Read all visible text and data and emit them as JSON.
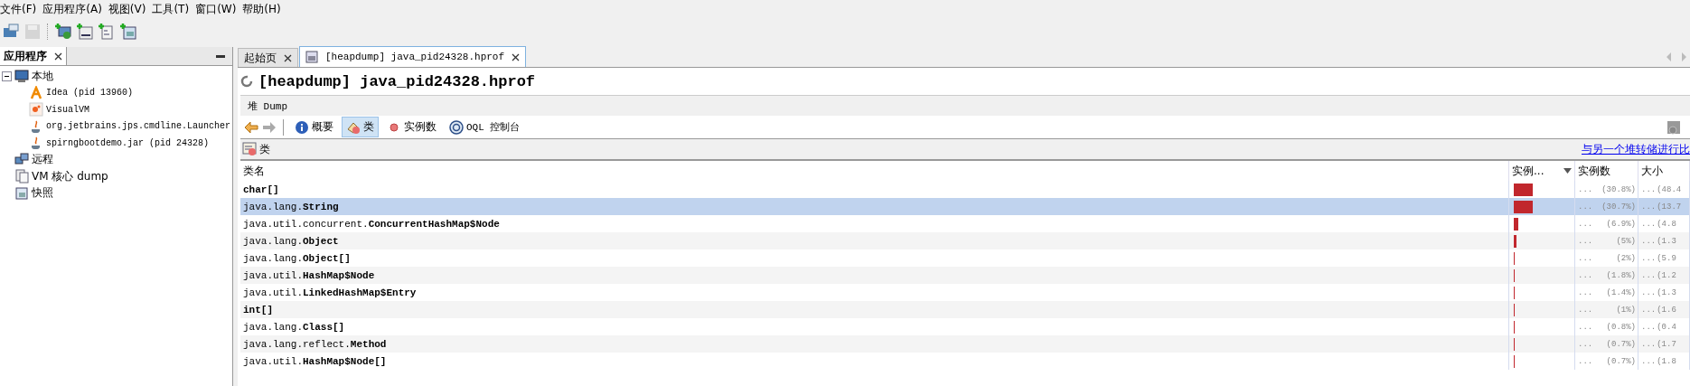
{
  "menu": [
    {
      "label": "文件(F)"
    },
    {
      "label": "应用程序(A)"
    },
    {
      "label": "视图(V)"
    },
    {
      "label": "工具(T)"
    },
    {
      "label": "窗口(W)"
    },
    {
      "label": "帮助(H)"
    }
  ],
  "toolbar": [
    {
      "kind": "open",
      "disabled": false
    },
    {
      "kind": "save",
      "disabled": true
    },
    {
      "kind": "add-host",
      "disabled": false
    },
    {
      "kind": "add-jmx",
      "disabled": false
    },
    {
      "kind": "add-dump",
      "disabled": false
    },
    {
      "kind": "add-snapshot",
      "disabled": false
    }
  ],
  "apps_panel": {
    "tab": "应用程序",
    "tree": [
      {
        "label": "本地",
        "kind": "host",
        "expanded": true,
        "children": [
          {
            "label": "Idea (pid 13960)",
            "kind": "idea"
          },
          {
            "label": "VisualVM",
            "kind": "visualvm"
          },
          {
            "label": "org.jetbrains.jps.cmdline.Launcher",
            "kind": "java"
          },
          {
            "label": "spirngbootdemo.jar (pid 24328)",
            "kind": "java"
          }
        ]
      },
      {
        "label": "远程",
        "kind": "remote"
      },
      {
        "label": "VM 核心 dump",
        "kind": "coredump"
      },
      {
        "label": "快照",
        "kind": "snapshot"
      }
    ]
  },
  "editor_tabs": [
    {
      "label": "起始页",
      "selected": false
    },
    {
      "label": "[heapdump] java_pid24328.hprof",
      "selected": true
    }
  ],
  "heap": {
    "title": "[heapdump] java_pid24328.hprof",
    "subtitle": "堆 Dump",
    "views": [
      {
        "label": "概要",
        "kind": "info",
        "selected": false
      },
      {
        "label": "类",
        "kind": "classes",
        "selected": true
      },
      {
        "label": "实例数",
        "kind": "instances",
        "selected": false
      },
      {
        "label": "OQL 控制台",
        "kind": "oql",
        "selected": false
      }
    ],
    "section": "类",
    "compare_link": "与另一个堆转储进行比",
    "table": {
      "columns": [
        "类名",
        "实例...",
        "实例数",
        "大小"
      ],
      "rows": [
        {
          "kind": "primitive",
          "name": "char[]",
          "level": 0.308,
          "count": "...",
          "count_pct": "(30.8%)",
          "size": "...",
          "size_pct": "(48.4",
          "selected": false
        },
        {
          "kind": "class",
          "name": "java.lang.**String**",
          "level": 0.307,
          "count": "...",
          "count_pct": "(30.7%)",
          "size": "...",
          "size_pct": "(13.7",
          "selected": true
        },
        {
          "kind": "class",
          "name": "java.util.concurrent.**ConcurrentHashMap$Node**",
          "level": 0.069,
          "count": "...",
          "count_pct": "(6.9%)",
          "size": "...",
          "size_pct": "(4.8",
          "selected": false
        },
        {
          "kind": "class",
          "name": "java.lang.**Object**",
          "level": 0.05,
          "count": "...",
          "count_pct": "(5%)",
          "size": "...",
          "size_pct": "(1.3",
          "selected": false
        },
        {
          "kind": "class",
          "name": "java.lang.**Object[]**",
          "level": 0.02,
          "count": "...",
          "count_pct": "(2%)",
          "size": "...",
          "size_pct": "(5.9",
          "selected": false
        },
        {
          "kind": "class",
          "name": "java.util.**HashMap$Node**",
          "level": 0.018,
          "count": "...",
          "count_pct": "(1.8%)",
          "size": "...",
          "size_pct": "(1.2",
          "selected": false
        },
        {
          "kind": "class",
          "name": "java.util.**LinkedHashMap$Entry**",
          "level": 0.014,
          "count": "...",
          "count_pct": "(1.4%)",
          "size": "...",
          "size_pct": "(1.3",
          "selected": false
        },
        {
          "kind": "primitive",
          "name": "int[]",
          "level": 0.01,
          "count": "...",
          "count_pct": "(1%)",
          "size": "...",
          "size_pct": "(1.6",
          "selected": false
        },
        {
          "kind": "class",
          "name": "java.lang.**Class[]**",
          "level": 0.008,
          "count": "...",
          "count_pct": "(0.8%)",
          "size": "...",
          "size_pct": "(0.4",
          "selected": false
        },
        {
          "kind": "class",
          "name": "java.lang.reflect.**Method**",
          "level": 0.007,
          "count": "...",
          "count_pct": "(0.7%)",
          "size": "...",
          "size_pct": "(1.7",
          "selected": false
        },
        {
          "kind": "class",
          "name": "java.util.**HashMap$Node[]**",
          "level": 0.007,
          "count": "...",
          "count_pct": "(0.7%)",
          "size": "...",
          "size_pct": "(1.8",
          "selected": false
        }
      ]
    }
  }
}
